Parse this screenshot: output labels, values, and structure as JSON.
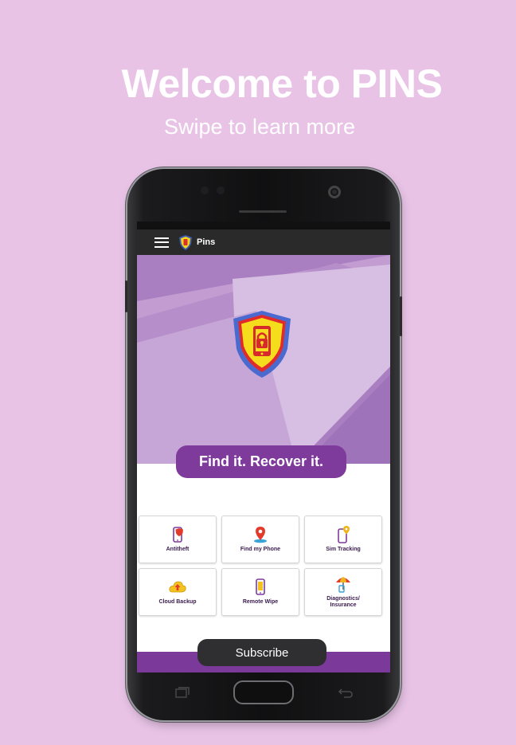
{
  "heading": {
    "title": "Welcome to PINS",
    "subtitle": "Swipe to learn more"
  },
  "app": {
    "title": "Pins",
    "tagline": "Find it. Recover it.",
    "subscribe_label": "Subscribe"
  },
  "features": [
    {
      "label": "Antitheft",
      "icon": "phone-shield-icon"
    },
    {
      "label": "Find my Phone",
      "icon": "map-pin-icon"
    },
    {
      "label": "Sim Tracking",
      "icon": "phone-location-icon"
    },
    {
      "label": "Cloud Backup",
      "icon": "cloud-upload-icon"
    },
    {
      "label": "Remote Wipe",
      "icon": "phone-wipe-icon"
    },
    {
      "label": "Diagnostics/ Insurance",
      "icon": "umbrella-icon"
    }
  ],
  "colors": {
    "background": "#e8c3e6",
    "hero": "#a97fc1",
    "accent_purple": "#7e3b9c",
    "app_bar": "#2b2a2b"
  }
}
